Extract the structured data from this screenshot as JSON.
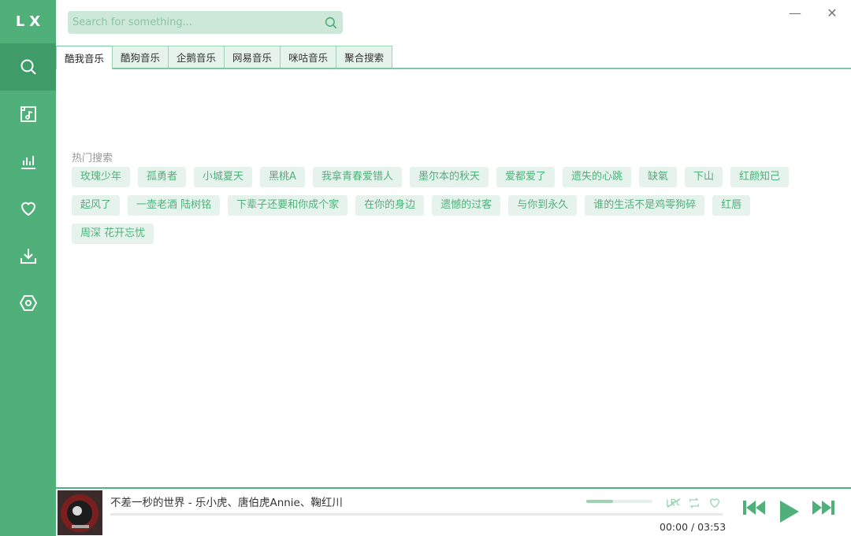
{
  "app": {
    "logo": "LX"
  },
  "sidebar": {
    "items": [
      {
        "name": "search",
        "icon": "search-icon",
        "active": true
      },
      {
        "name": "playlist",
        "icon": "music-file-icon",
        "active": false
      },
      {
        "name": "leaderboard",
        "icon": "bar-chart-icon",
        "active": false
      },
      {
        "name": "favorites",
        "icon": "heart-icon",
        "active": false
      },
      {
        "name": "download",
        "icon": "download-icon",
        "active": false
      },
      {
        "name": "settings",
        "icon": "hexagon-settings-icon",
        "active": false
      }
    ]
  },
  "search": {
    "placeholder": "Search for something...",
    "value": ""
  },
  "window_controls": {
    "minimize": "—",
    "close": "✕"
  },
  "tabs": [
    "酷我音乐",
    "酷狗音乐",
    "企鹅音乐",
    "网易音乐",
    "咪咕音乐",
    "聚合搜索"
  ],
  "active_tab": 0,
  "hot_search": {
    "label": "热门搜索",
    "items": [
      "玫瑰少年",
      "孤勇者",
      "小城夏天",
      "黑桃A",
      "我拿青春爱错人",
      "墨尔本的秋天",
      "爱都爱了",
      "遗失的心跳",
      "缺氧",
      "下山",
      "红颜知己",
      "起风了",
      "一壶老酒 陆树铭",
      "下辈子还要和你成个家",
      "在你的身边",
      "遗憾的过客",
      "与你到永久",
      "谁的生活不是鸡零狗碎",
      "红唇",
      "周深 花开忘忧"
    ]
  },
  "player": {
    "song": "不差一秒的世界 - 乐小虎、唐伯虎Annie、鞠红川",
    "time": "00:00 / 03:53",
    "progress": 0,
    "volume": 0.4
  },
  "colors": {
    "accent": "#4fb07a",
    "accent_dark": "#3f9c69",
    "tag_bg": "#e6f3ec"
  }
}
